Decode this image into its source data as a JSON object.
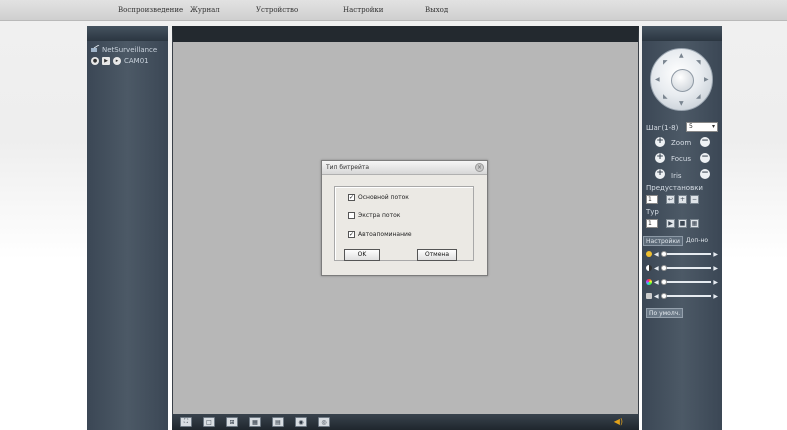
{
  "menu": [
    {
      "label": "Воспроизведение"
    },
    {
      "label": "Журнал"
    },
    {
      "label": "Устройство"
    },
    {
      "label": "Настройки"
    },
    {
      "label": "Выход"
    }
  ],
  "device_tree": {
    "root_label": "NetSurveillance",
    "camera_label": "CAM01"
  },
  "dialog": {
    "title": "Тип битрейта",
    "options": [
      {
        "label": "Основной поток",
        "checked": true
      },
      {
        "label": "Экстра поток",
        "checked": false
      },
      {
        "label": "Автоапоминание",
        "checked": true
      }
    ],
    "ok_label": "OK",
    "cancel_label": "Отмена"
  },
  "ptz": {
    "step_label": "Шаг(1-8)",
    "step_value": "5",
    "zoom_label": "Zoom",
    "focus_label": "Focus",
    "iris_label": "Iris",
    "presets_label": "Предустановки",
    "preset_value": "1",
    "tour_label": "Тур",
    "tour_value": "1",
    "tabs": [
      {
        "label": "Настройки"
      },
      {
        "label": "Доп-но"
      }
    ],
    "sliders": [
      {
        "icon": "brightness-icon",
        "color": "#f0c030",
        "level": 0.0
      },
      {
        "icon": "contrast-icon",
        "color": "#ffffff",
        "level": 0.0
      },
      {
        "icon": "saturation-icon",
        "color": "#c040ff",
        "level": 0.0
      },
      {
        "icon": "hue-icon",
        "color": "#cccccc",
        "level": 0.0
      }
    ],
    "default_label": "По умолч."
  },
  "toolbar": {
    "buttons": [
      "fullscreen-icon",
      "single-view-icon",
      "quad-view-icon",
      "nine-view-icon",
      "sixteen-view-icon",
      "record-icon",
      "snapshot-icon"
    ]
  },
  "colors": {
    "panel": "#3b4755",
    "video_bg": "#b7b7b7",
    "volume": "#e3a21a"
  }
}
